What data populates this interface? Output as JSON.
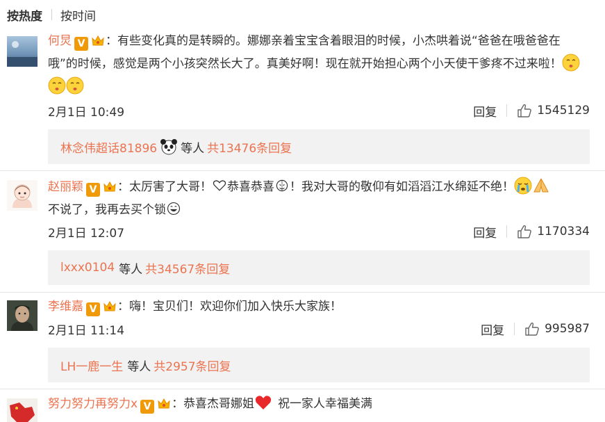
{
  "sort": {
    "active": "按热度",
    "other": "按时间"
  },
  "comments": [
    {
      "user": "何炅",
      "text": "有些变化真的是转瞬的。娜娜亲着宝宝含着眼泪的时候，小杰哄着说“爸爸在哦爸爸在哦”的时候，感觉是两个小孩突然长大了。真美好啊！现在就开始担心两个小天使干爹疼不过来啦！",
      "time": "2月1日 10:49",
      "reply_label": "回复",
      "likes": "1545129",
      "sub_user": "林念伟超话81896",
      "sub_suffix": "等人",
      "sub_count": "共13476条回复"
    },
    {
      "user": "赵丽颖",
      "text_a": "太厉害了大哥！",
      "text_b": "恭喜恭喜",
      "text_c": "！我对大哥的敬仰有如滔滔江水绵延不绝！",
      "text_d": "不说了，我再去买个锁",
      "time": "2月1日 12:07",
      "reply_label": "回复",
      "likes": "1170334",
      "sub_user": "lxxx0104",
      "sub_suffix": "等人",
      "sub_count": "共34567条回复"
    },
    {
      "user": "李维嘉",
      "text": "嗨！宝贝们！欢迎你们加入快乐大家族！",
      "time": "2月1日 11:14",
      "reply_label": "回复",
      "likes": "995987",
      "sub_user": "LH一鹿一生",
      "sub_suffix": "等人",
      "sub_count": "共2957条回复"
    },
    {
      "user": "努力努力再努力x",
      "text_a": "恭喜杰哥娜姐",
      "text_b": "祝一家人幸福美满"
    }
  ],
  "icons": {
    "verified": "verified-v-badge-icon",
    "member": "member-crown-icon",
    "like": "thumbs-up-icon"
  },
  "colors": {
    "accent": "#eb7350",
    "badge": "#f09a0a",
    "sub_bg": "#f2f2f2"
  }
}
